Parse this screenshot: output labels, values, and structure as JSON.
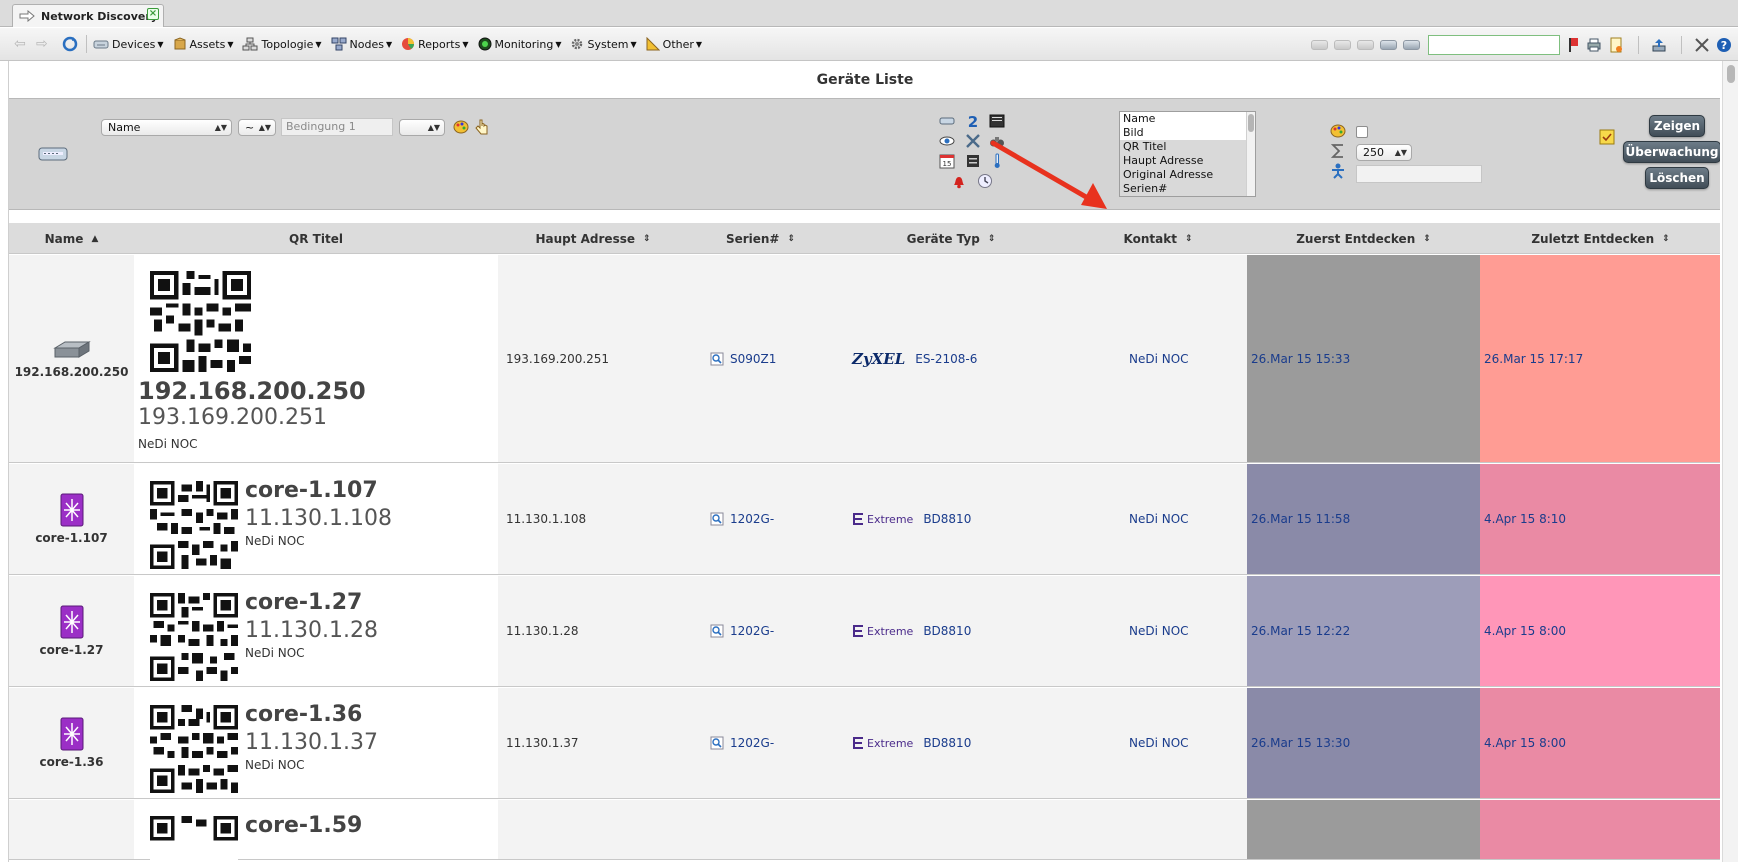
{
  "tab": {
    "title": "Network Discovery"
  },
  "toolbar": {
    "menus": [
      "Devices",
      "Assets",
      "Topologie",
      "Nodes",
      "Reports",
      "Monitoring",
      "System",
      "Other"
    ],
    "search_value": ""
  },
  "page": {
    "title": "Geräte Liste"
  },
  "filter": {
    "field": "Name",
    "operator": "~",
    "condition_placeholder": "Bedingung 1",
    "logic": "",
    "columns": [
      "Name",
      "Bild",
      "QR Titel",
      "Haupt Adresse",
      "Original Adresse",
      "Serien#"
    ],
    "selected_columns": [
      "QR Titel",
      "Haupt Adresse",
      "Original Adresse",
      "Serien#"
    ],
    "limit": "250",
    "search_value": "",
    "buttons": {
      "show": "Zeigen",
      "monitor": "Überwachung",
      "delete": "Löschen"
    }
  },
  "table": {
    "headers": [
      "Name",
      "QR Titel",
      "Haupt Adresse",
      "Serien#",
      "Geräte Typ",
      "Kontakt",
      "Zuerst Entdecken",
      "Zuletzt Entdecken"
    ],
    "rows": [
      {
        "name": "192.168.200.250",
        "qr_title": "192.168.200.250",
        "qr_addr": "193.169.200.251",
        "qr_contact": "NeDi NOC",
        "address": "193.169.200.251",
        "serial": "S090Z1",
        "vendor": "ZyXEL",
        "type": "ES-2108-6",
        "contact": "NeDi NOC",
        "first": "26.Mar 15 15:33",
        "last": "26.Mar 15 17:17",
        "first_color": "#9b9b9b",
        "last_color": "#ff9c94"
      },
      {
        "name": "core-1.107",
        "qr_title": "core-1.107",
        "qr_addr": "11.130.1.108",
        "qr_contact": "NeDi NOC",
        "address": "11.130.1.108",
        "serial": "1202G-",
        "vendor": "Extreme",
        "type": "BD8810",
        "contact": "NeDi NOC",
        "first": "26.Mar 15 11:58",
        "last": "4.Apr 15 8:10",
        "first_color": "#8a8aa8",
        "last_color": "#ea8aa4"
      },
      {
        "name": "core-1.27",
        "qr_title": "core-1.27",
        "qr_addr": "11.130.1.28",
        "qr_contact": "NeDi NOC",
        "address": "11.130.1.28",
        "serial": "1202G-",
        "vendor": "Extreme",
        "type": "BD8810",
        "contact": "NeDi NOC",
        "first": "26.Mar 15 12:22",
        "last": "4.Apr 15 8:00",
        "first_color": "#9d9db9",
        "last_color": "#ff96b8"
      },
      {
        "name": "core-1.36",
        "qr_title": "core-1.36",
        "qr_addr": "11.130.1.37",
        "qr_contact": "NeDi NOC",
        "address": "11.130.1.37",
        "serial": "1202G-",
        "vendor": "Extreme",
        "type": "BD8810",
        "contact": "NeDi NOC",
        "first": "26.Mar 15 13:30",
        "last": "4.Apr 15 8:00",
        "first_color": "#8a8aa8",
        "last_color": "#ea8aa4"
      },
      {
        "name": "",
        "qr_title": "core-1.59",
        "qr_addr": "",
        "qr_contact": "",
        "address": "",
        "serial": "",
        "vendor": "",
        "type": "",
        "contact": "",
        "first": "",
        "last": "",
        "first_color": "#9b9b9b",
        "last_color": "#ea8aa4"
      }
    ]
  },
  "colors": {
    "button_dark": "#414d57",
    "link": "#1a3c8c",
    "panel": "#d4d4d4",
    "arrow": "#e8321e"
  }
}
